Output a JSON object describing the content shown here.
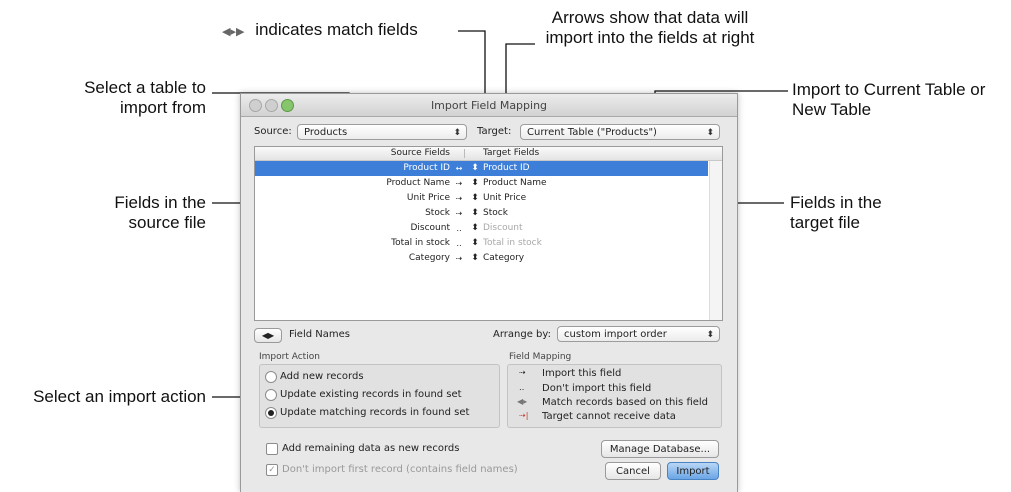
{
  "callouts": {
    "match_fields": "indicates match fields",
    "arrows_1": "Arrows show that data will",
    "arrows_2": "import into the fields at right",
    "select_table_1": "Select a table to",
    "select_table_2": "import from",
    "import_to_1": "Import to Current Table or",
    "import_to_2": "New Table",
    "fields_source_1": "Fields in the",
    "fields_source_2": "source file",
    "fields_target_1": "Fields in the",
    "fields_target_2": "target file",
    "select_action": "Select an import action"
  },
  "window": {
    "title": "Import Field Mapping",
    "source_label": "Source:",
    "source_value": "Products",
    "target_label": "Target:",
    "target_value": "Current Table (\"Products\")",
    "header_source": "Source Fields",
    "header_target": "Target Fields",
    "rows": [
      {
        "source": "Product ID",
        "arrow": "↔",
        "target": "Product ID",
        "dim": false
      },
      {
        "source": "Product Name",
        "arrow": "⇢",
        "target": "Product Name",
        "dim": false
      },
      {
        "source": "Unit Price",
        "arrow": "⇢",
        "target": "Unit Price",
        "dim": false
      },
      {
        "source": "Stock",
        "arrow": "⇢",
        "target": "Stock",
        "dim": false
      },
      {
        "source": "Discount",
        "arrow": "‥",
        "target": "Discount",
        "dim": true
      },
      {
        "source": "Total in stock",
        "arrow": "‥",
        "target": "Total in stock",
        "dim": true
      },
      {
        "source": "Category",
        "arrow": "⇢",
        "target": "Category",
        "dim": false
      }
    ],
    "field_names_label": "Field Names",
    "arrange_label": "Arrange by:",
    "arrange_value": "custom import order",
    "import_action_title": "Import Action",
    "action_add": "Add new records",
    "action_update_existing": "Update existing records in found set",
    "action_update_matching": "Update matching records in found set",
    "field_mapping_title": "Field Mapping",
    "legend_import": "Import this field",
    "legend_dont": "Don't import this field",
    "legend_match": "Match records based on this field",
    "legend_cannot": "Target cannot receive data",
    "add_remaining": "Add remaining data as new records",
    "dont_import_first": "Don't import first record (contains field names)",
    "manage_db": "Manage Database...",
    "cancel": "Cancel",
    "import": "Import"
  }
}
